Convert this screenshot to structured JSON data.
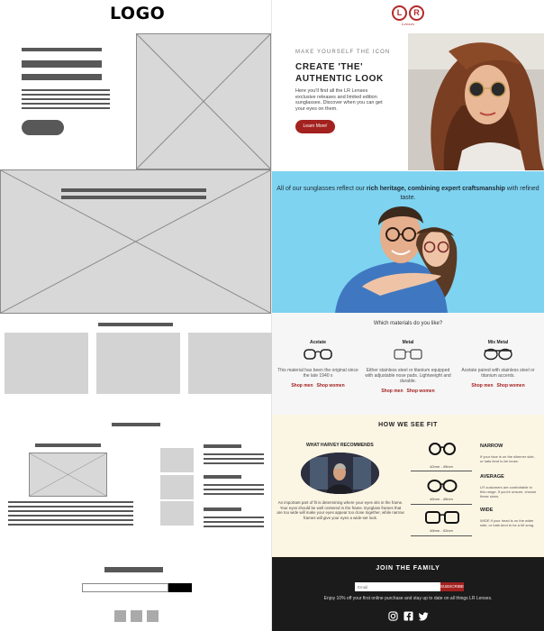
{
  "left_logo": "LOGO",
  "brand_logo": {
    "letters": [
      "L",
      "R"
    ],
    "tagline": "Lenses"
  },
  "hero": {
    "eyebrow": "MAKE YOURSELF THE ICON",
    "title_line1": "CREATE 'THE'",
    "title_line2": "AUTHENTIC LOOK",
    "body": "Here you'll find all the LR Lenses exclusive releases and limited edition sunglasses. Discover when you can get your eyes on them.",
    "button": "Learn More!"
  },
  "heritage": {
    "text_a": "All of our sunglasses reflect our ",
    "text_b": "rich heritage, combining expert craftsmanship",
    "text_c": " with refined taste."
  },
  "materials": {
    "question": "Which materials do you like?",
    "items": [
      {
        "name": "Acetate",
        "desc": "This material has been the original since the late 1940 s",
        "men": "Shop men",
        "women": "Shop women"
      },
      {
        "name": "Metal",
        "desc": "Either stainless steel or titanium equipped with adjustable nose pads. Lightweight and durable.",
        "men": "Shop men",
        "women": "Shop women"
      },
      {
        "name": "Mix Metal",
        "desc": "Acetate paired with stainless steel or titanium accents.",
        "men": "Shop men",
        "women": "Shop women"
      }
    ]
  },
  "fit": {
    "title": "HOW WE SEE FIT",
    "recommend_title": "WHAT HARVEY RECOMMENDS",
    "recommend_body": "An important part of fit is determining where your eyes sits in the frame. Your eyes should be well centered in the frame. Eyeglass frames that are too wide will make your eyes appear too close together, while narrow frames will give your eyes a wide-set look.",
    "sizes": [
      {
        "range": "42mm - 45mm",
        "label": "NARROW",
        "desc": "If your face is on the slimmer side, or hats tend to be loose."
      },
      {
        "range": "46mm - 49mm",
        "label": "AVERAGE",
        "desc": "LR customers are comfortable in this range. If you're unsure, choose these sizes."
      },
      {
        "range": "49mm - 52mm",
        "label": "WIDE",
        "desc": "WIDE If your head is on the wider side, or hats tend to be a bit snug."
      }
    ]
  },
  "footer": {
    "join": "JOIN THE FAMILY",
    "email_placeholder": "Email",
    "subscribe": "SUBSCRIBE",
    "enjoy": "Enjoy 10% off your first online purchase and stay up to date on all things LR Lenses."
  },
  "icons": [
    "instagram-icon",
    "facebook-icon",
    "twitter-icon"
  ],
  "colors": {
    "accent": "#a3211f",
    "band_blue": "#7ed3f0",
    "cream": "#fbf5e4",
    "footer_dark": "#1b1b1b",
    "wire_gray": "#585858"
  }
}
